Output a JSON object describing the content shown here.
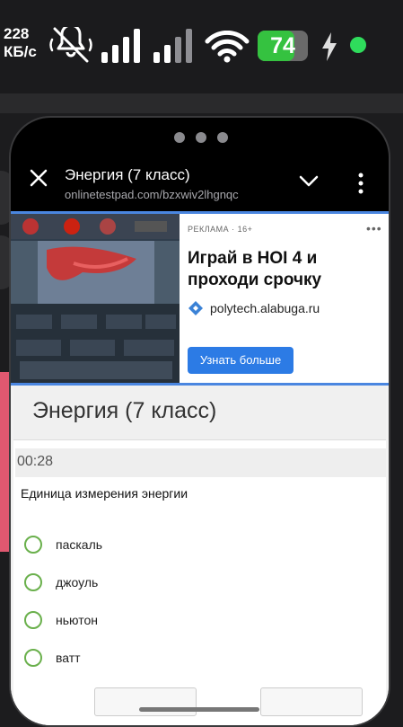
{
  "status_bar": {
    "speed_value": "228",
    "speed_unit": "КБ/с",
    "battery_level": "74",
    "battery_fraction": 0.74,
    "icons": [
      "mute-vibrate-icon",
      "signal-icon",
      "signal-icon",
      "wifi-icon",
      "battery-icon",
      "charging-icon",
      "status-dot-icon"
    ]
  },
  "browser": {
    "title": "Энергия (7 класс)",
    "url": "onlinetestpad.com/bzxwiv2lhgnqc",
    "close_icon": "close-icon",
    "chevron_icon": "chevron-down-icon",
    "menu_icon": "more-vert-icon"
  },
  "ad": {
    "label": "РЕКЛАМА · 16+",
    "more": "•••",
    "headline": "Играй в HOI 4 и проходи срочку",
    "domain": "polytech.alabuga.ru",
    "button": "Узнать больше"
  },
  "test": {
    "title": "Энергия (7 класс)",
    "timer": "00:28",
    "question": "Единица измерения энергии",
    "options": [
      "паскаль",
      "джоуль",
      "ньютон",
      "ватт"
    ]
  },
  "colors": {
    "accent_blue": "#2c7be5",
    "radio_green": "#6ab04c",
    "battery_green": "#35c240"
  }
}
